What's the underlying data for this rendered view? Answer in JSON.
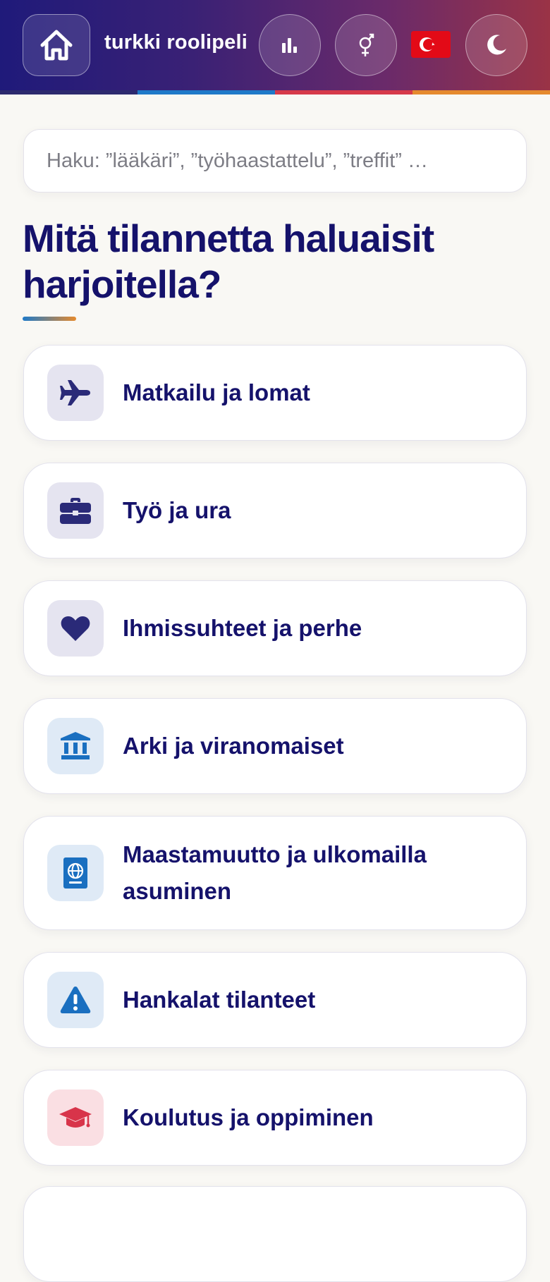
{
  "header": {
    "title": "turkki roolipeli",
    "home_icon": "home-icon",
    "stats_icon": "bar-chart-icon",
    "gender_icon": "gender-icon",
    "flag_icon": "turkey-flag-icon",
    "theme_icon": "moon-icon",
    "gradient_colors": [
      "#1f1a7a",
      "#9a3346"
    ],
    "stripe_colors": [
      "#2d2a6e",
      "#1f7ac8",
      "#d63a4a",
      "#e58a2e"
    ]
  },
  "search": {
    "placeholder": "Haku: ”lääkäri”, ”työhaastattelu”, ”treffit” …",
    "value": ""
  },
  "main": {
    "heading": "Mitä tilannetta haluaisit harjoitella?",
    "categories": [
      {
        "label": "Matkailu ja lomat",
        "icon": "airplane-icon",
        "icon_color": "#2a2a78"
      },
      {
        "label": "Työ ja ura",
        "icon": "briefcase-icon",
        "icon_color": "#2a2a78"
      },
      {
        "label": "Ihmissuhteet ja perhe",
        "icon": "heart-icon",
        "icon_color": "#2a2a78"
      },
      {
        "label": "Arki ja viranomaiset",
        "icon": "bank-building-icon",
        "icon_color": "#1a6fc0"
      },
      {
        "label": "Maastamuutto ja ulkomailla asuminen",
        "icon": "passport-icon",
        "icon_color": "#1a6fc0"
      },
      {
        "label": "Hankalat tilanteet",
        "icon": "warning-icon",
        "icon_color": "#1a6fc0"
      },
      {
        "label": "Koulutus ja oppiminen",
        "icon": "graduation-cap-icon",
        "icon_color": "#d8344a"
      }
    ]
  }
}
